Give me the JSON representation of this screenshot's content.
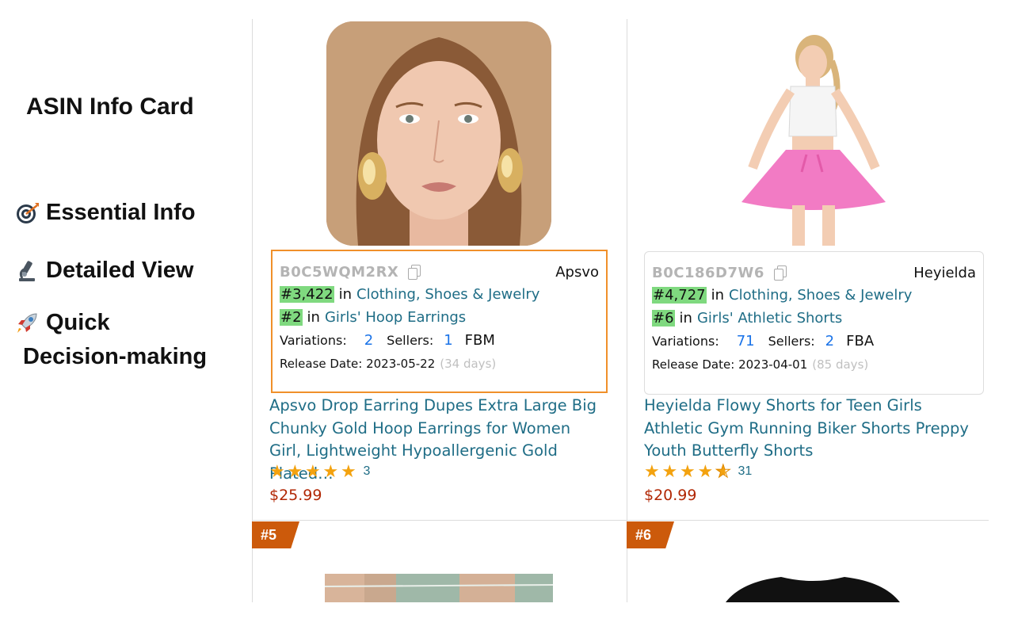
{
  "promo": {
    "title": "ASIN Info Card",
    "features": [
      {
        "icon": "target-icon",
        "label": "Essential Info"
      },
      {
        "icon": "microscope-icon",
        "label": "Detailed View"
      },
      {
        "icon": "rocket-icon",
        "label": "Quick"
      }
    ],
    "quick_line2": "Decision-making"
  },
  "products": [
    {
      "asin": "B0C5WQM2RX",
      "brand": "Apsvo",
      "ranks": [
        {
          "num": "#3,422",
          "in": "in",
          "category": "Clothing, Shoes & Jewelry"
        },
        {
          "num": "#2",
          "in": "in",
          "category": "Girls' Hoop Earrings"
        }
      ],
      "variations_label": "Variations:",
      "variations": "2",
      "sellers_label": "Sellers:",
      "sellers": "1",
      "fulfillment": "FBM",
      "release_label": "Release Date:",
      "release_date": "2023-05-22",
      "release_age": "(34 days)",
      "title": "Apsvo Drop Earring Dupes Extra Large Big Chunky Gold Hoop Earrings for Women Girl, Lightweight Hypoallergenic Gold Plated…",
      "rating": 5,
      "review_count": "3",
      "price": "$25.99"
    },
    {
      "asin": "B0C186D7W6",
      "brand": "Heyielda",
      "ranks": [
        {
          "num": "#4,727",
          "in": "in",
          "category": "Clothing, Shoes & Jewelry"
        },
        {
          "num": "#6",
          "in": "in",
          "category": "Girls' Athletic Shorts"
        }
      ],
      "variations_label": "Variations:",
      "variations": "71",
      "sellers_label": "Sellers:",
      "sellers": "2",
      "fulfillment": "FBA",
      "release_label": "Release Date:",
      "release_date": "2023-04-01",
      "release_age": "(85 days)",
      "title": "Heyielda Flowy Shorts for Teen Girls Athletic Gym Running Biker Shorts Preppy Youth Butterfly Shorts",
      "rating": 4.5,
      "review_count": "31",
      "price": "$20.99"
    }
  ],
  "badges": [
    "#5",
    "#6"
  ],
  "colors": {
    "highlight_card_border": "#f0902a",
    "rank_highlight": "#7fd97f",
    "link": "#1f6d86",
    "price": "#b12704",
    "badge": "#cc5a0b",
    "star": "#f3a20f"
  }
}
